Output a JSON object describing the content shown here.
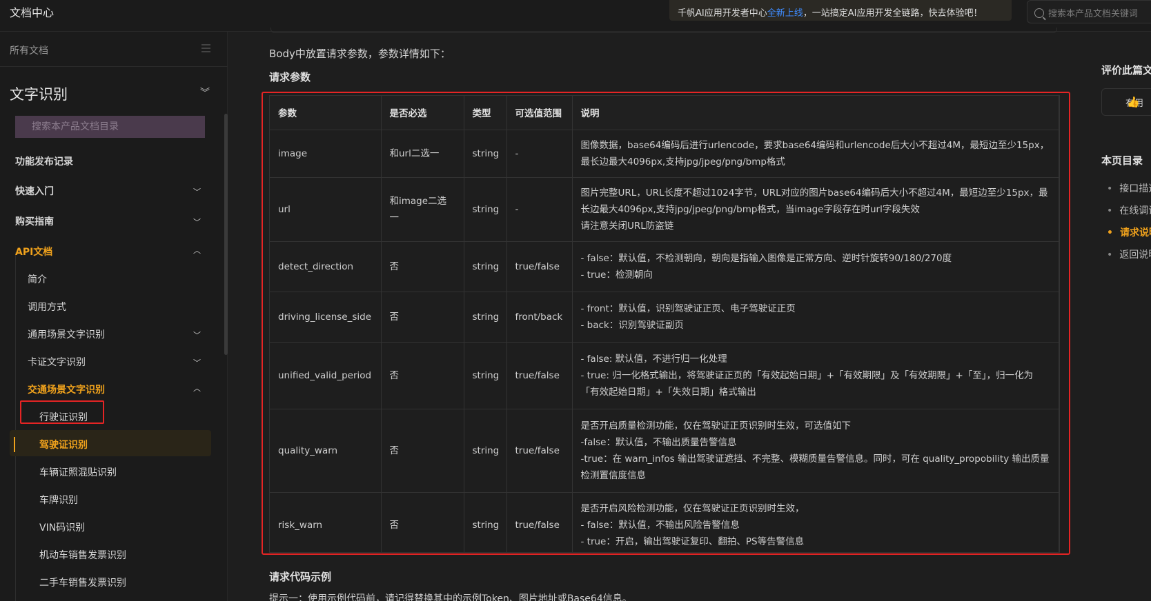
{
  "header": {
    "brand": "文档中心",
    "promo_prefix": "千帆AI应用开发者中心",
    "promo_highlight": "全新上线",
    "promo_suffix": "，一站搞定AI应用开发全链路，快去体验吧！",
    "search_placeholder": "搜索本产品文档关键词"
  },
  "sidebar": {
    "all_docs": "所有文档",
    "product_title": "文字识别",
    "search_placeholder": "搜索本产品文档目录",
    "items": [
      {
        "label": "功能发布记录"
      },
      {
        "label": "快速入门"
      },
      {
        "label": "购买指南"
      },
      {
        "label": "API文档"
      },
      {
        "label": "简介"
      },
      {
        "label": "调用方式"
      },
      {
        "label": "通用场景文字识别"
      },
      {
        "label": "卡证文字识别"
      },
      {
        "label": "交通场景文字识别"
      },
      {
        "label": "行驶证识别"
      },
      {
        "label": "驾驶证识别"
      },
      {
        "label": "车辆证照混贴识别"
      },
      {
        "label": "车牌识别"
      },
      {
        "label": "VIN码识别"
      },
      {
        "label": "机动车销售发票识别"
      },
      {
        "label": "二手车销售发票识别"
      }
    ]
  },
  "main": {
    "intro": "Body中放置请求参数，参数详情如下：",
    "section_title": "请求参数",
    "table": {
      "headers": [
        "参数",
        "是否必选",
        "类型",
        "可选值范围",
        "说明"
      ],
      "rows": [
        {
          "param": "image",
          "required": "和url二选一",
          "type": "string",
          "range": "-",
          "desc": [
            "图像数据，base64编码后进行urlencode，要求base64编码和urlencode后大小不超过4M，最短边至少15px，最长边最大4096px,支持jpg/jpeg/png/bmp格式"
          ]
        },
        {
          "param": "url",
          "required": "和image二选一",
          "type": "string",
          "range": "-",
          "desc": [
            "图片完整URL，URL长度不超过1024字节，URL对应的图片base64编码后大小不超过4M，最短边至少15px，最长边最大4096px,支持jpg/jpeg/png/bmp格式，当image字段存在时url字段失效",
            "请注意关闭URL防盗链"
          ]
        },
        {
          "param": "detect_direction",
          "required": "否",
          "type": "string",
          "range": "true/false",
          "desc": [
            "- false：默认值，不检测朝向，朝向是指输入图像是正常方向、逆时针旋转90/180/270度",
            "- true：检测朝向"
          ]
        },
        {
          "param": "driving_license_side",
          "required": "否",
          "type": "string",
          "range": "front/back",
          "desc": [
            "- front：默认值，识别驾驶证正页、电子驾驶证正页",
            "- back：识别驾驶证副页"
          ]
        },
        {
          "param": "unified_valid_period",
          "required": "否",
          "type": "string",
          "range": "true/false",
          "desc": [
            "- false: 默认值，不进行归一化处理",
            "- true: 归一化格式输出，将驾驶证正页的「有效起始日期」+「有效期限」及「有效期限」+「至」，归一化为「有效起始日期」+「失效日期」格式输出"
          ]
        },
        {
          "param": "quality_warn",
          "required": "否",
          "type": "string",
          "range": "true/false",
          "desc": [
            "是否开启质量检测功能，仅在驾驶证正页识别时生效，可选值如下",
            "-false：默认值，不输出质量告警信息",
            "-true：在 warn_infos 输出驾驶证遮挡、不完整、模糊质量告警信息。同时，可在 quality_propobility 输出质量检测置信度信息"
          ]
        },
        {
          "param": "risk_warn",
          "required": "否",
          "type": "string",
          "range": "true/false",
          "desc": [
            "是否开启风险检测功能，仅在驾驶证正页识别时生效，",
            "- false：默认值，不输出风险告警信息",
            "- true：开启，输出驾驶证复印、翻拍、PS等告警信息"
          ]
        }
      ]
    },
    "code_title": "请求代码示例",
    "tip": "提示一：使用示例代码前，请记得替换其中的示例Token、图片地址或Base64信息。"
  },
  "right": {
    "rate_title": "评价此篇文章",
    "rate_btn": "有用",
    "toc_title": "本页目录",
    "toc": [
      {
        "label": "接口描述"
      },
      {
        "label": "在线调试"
      },
      {
        "label": "请求说明"
      },
      {
        "label": "返回说明"
      }
    ]
  }
}
